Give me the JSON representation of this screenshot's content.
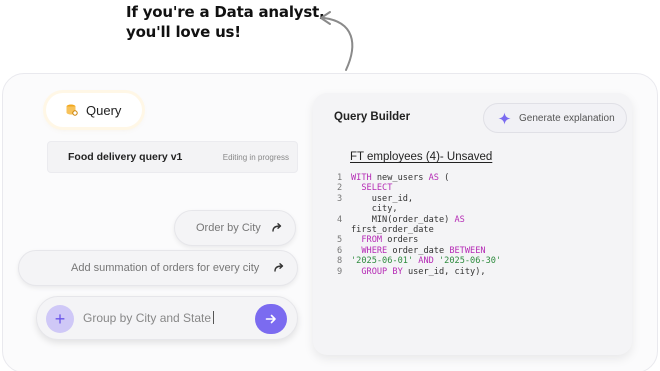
{
  "tagline": {
    "line1": "If you're a Data analyst,",
    "line2": "you'll love us!"
  },
  "query_tab": {
    "label": "Query",
    "icon": "database-search-icon"
  },
  "saved_query": {
    "title": "Food delivery query v1",
    "status": "Editing in progress"
  },
  "suggestions": [
    {
      "label": "Order by City"
    },
    {
      "label": "Add summation of orders for every city"
    }
  ],
  "prompt_input": {
    "value": "Group by City and State"
  },
  "query_builder": {
    "title": "Query Builder",
    "generate_label": "Generate explanation",
    "document_title": "FT employees (4)- Unsaved"
  },
  "code_lines": [
    {
      "n": "1",
      "tokens": [
        {
          "t": "WITH",
          "c": "kw"
        },
        {
          "t": " new_users "
        },
        {
          "t": "AS",
          "c": "kw"
        },
        {
          "t": " ("
        }
      ]
    },
    {
      "n": "2",
      "tokens": [
        {
          "t": "  "
        },
        {
          "t": "SELECT",
          "c": "kw"
        }
      ]
    },
    {
      "n": "3",
      "tokens": [
        {
          "t": "    user_id,"
        }
      ]
    },
    {
      "n": "",
      "tokens": [
        {
          "t": "    city,"
        }
      ]
    },
    {
      "n": "4",
      "tokens": [
        {
          "t": "    MIN(order_date) "
        },
        {
          "t": "AS",
          "c": "kw"
        }
      ]
    },
    {
      "n": "",
      "tokens": [
        {
          "t": "first_order_date"
        }
      ]
    },
    {
      "n": "5",
      "tokens": [
        {
          "t": "  "
        },
        {
          "t": "FROM",
          "c": "kw"
        },
        {
          "t": " orders"
        }
      ]
    },
    {
      "n": "6",
      "tokens": [
        {
          "t": "  "
        },
        {
          "t": "WHERE",
          "c": "kw"
        },
        {
          "t": " order_date "
        },
        {
          "t": "BETWEEN",
          "c": "kw"
        }
      ]
    },
    {
      "n": "8",
      "tokens": [
        {
          "t": "'2025-06-01'",
          "c": "str"
        },
        {
          "t": " "
        },
        {
          "t": "AND",
          "c": "kw"
        },
        {
          "t": " "
        },
        {
          "t": "'2025-06-30'",
          "c": "str"
        }
      ]
    },
    {
      "n": "9",
      "tokens": [
        {
          "t": "  "
        },
        {
          "t": "GROUP BY",
          "c": "kw"
        },
        {
          "t": " user_id, city),"
        }
      ]
    }
  ],
  "colors": {
    "accent": "#7b6bf0",
    "accent_light": "#cfc8f7",
    "keyword": "#b52bb5",
    "string": "#2e8b3e"
  }
}
